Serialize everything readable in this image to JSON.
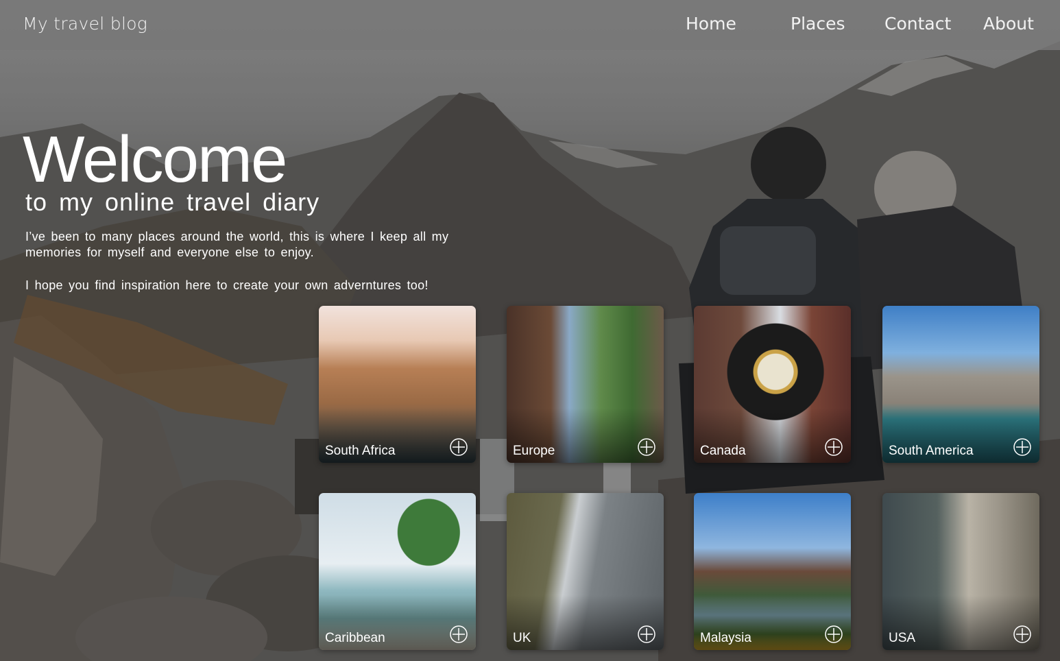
{
  "header": {
    "brand": "My travel blog",
    "nav": [
      "Home",
      "Places",
      "Contact",
      "About"
    ]
  },
  "hero": {
    "title": "Welcome",
    "subtitle": "to my online travel diary",
    "paragraph1": "I’ve been to many places around the world, this is where I keep all my memories for myself and everyone else to enjoy.",
    "paragraph2": "I hope you find inspiration here to create your own adverntures too!"
  },
  "places": [
    {
      "name": "South Africa",
      "icon": "add-circle-icon"
    },
    {
      "name": "Europe",
      "icon": "add-circle-icon"
    },
    {
      "name": "Canada",
      "icon": "add-circle-icon"
    },
    {
      "name": "South America",
      "icon": "add-circle-icon"
    },
    {
      "name": "Caribbean",
      "icon": "add-circle-icon"
    },
    {
      "name": "UK",
      "icon": "add-circle-icon"
    },
    {
      "name": "Malaysia",
      "icon": "add-circle-icon"
    },
    {
      "name": "USA",
      "icon": "add-circle-icon"
    }
  ]
}
